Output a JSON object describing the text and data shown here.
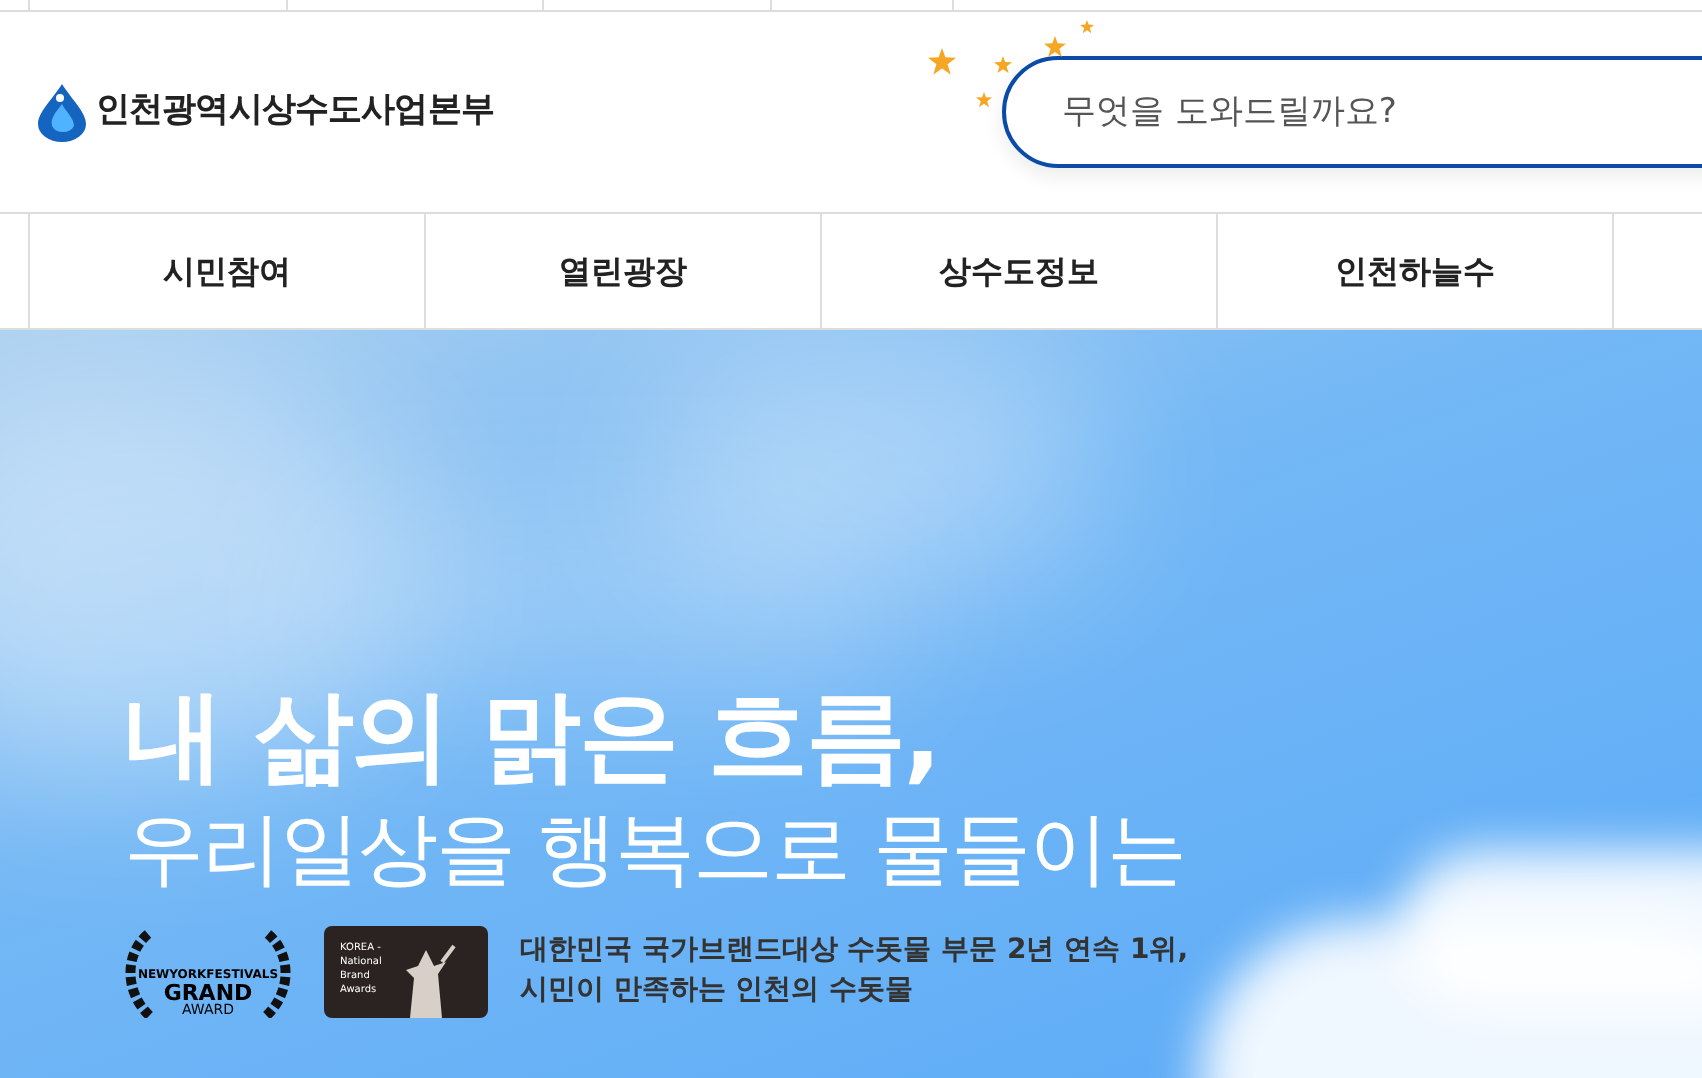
{
  "header": {
    "logo_text": "인천광역시상수도사업본부",
    "search": {
      "placeholder": "무엇을 도와드릴까요?"
    }
  },
  "nav": {
    "items": [
      {
        "label": "시민참여"
      },
      {
        "label": "열린광장"
      },
      {
        "label": "상수도정보"
      },
      {
        "label": "인천하늘수"
      }
    ]
  },
  "hero": {
    "headline": "내 삶의 맑은 흐름,",
    "subheadline": "우리일상을 행복으로 물들이는",
    "awards": [
      {
        "kind": "wreath",
        "lines": [
          "NEWYORKFESTIVALS",
          "GRAND",
          "AWARD"
        ]
      },
      {
        "kind": "plaque",
        "lines": [
          "KOREA -",
          "National",
          "Brand",
          "Awards"
        ]
      }
    ],
    "award_text": [
      "대한민국 국가브랜드대상 수돗물 부문 2년 연속 1위,",
      "시민이 만족하는 인천의 수돗물"
    ]
  }
}
